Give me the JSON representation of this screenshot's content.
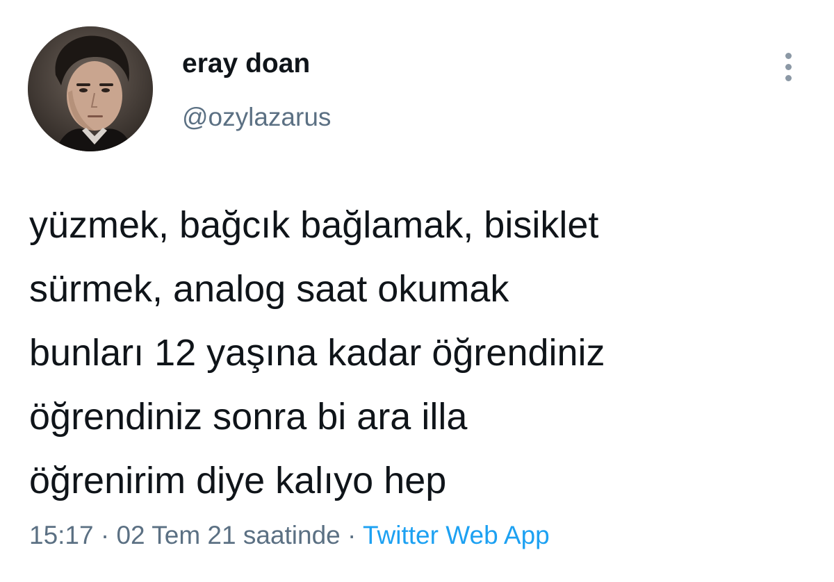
{
  "author": {
    "display_name": "eray doan",
    "handle": "@ozylazarus"
  },
  "tweet": {
    "lines": [
      "yüzmek, bağcık bağlamak, bisiklet",
      "sürmek, analog saat okumak",
      "bunları 12 yaşına kadar öğrendiniz",
      "öğrendiniz sonra bi ara illa",
      "öğrenirim diye kalıyo hep"
    ],
    "time": "15:17",
    "date": "02 Tem 21 saatinde",
    "separator": "·",
    "source": "Twitter Web App"
  },
  "icons": {
    "more": "more-vertical-icon",
    "avatar": "profile-photo"
  },
  "colors": {
    "text": "#0f1419",
    "secondary": "#5b7083",
    "link": "#1da1f2"
  }
}
